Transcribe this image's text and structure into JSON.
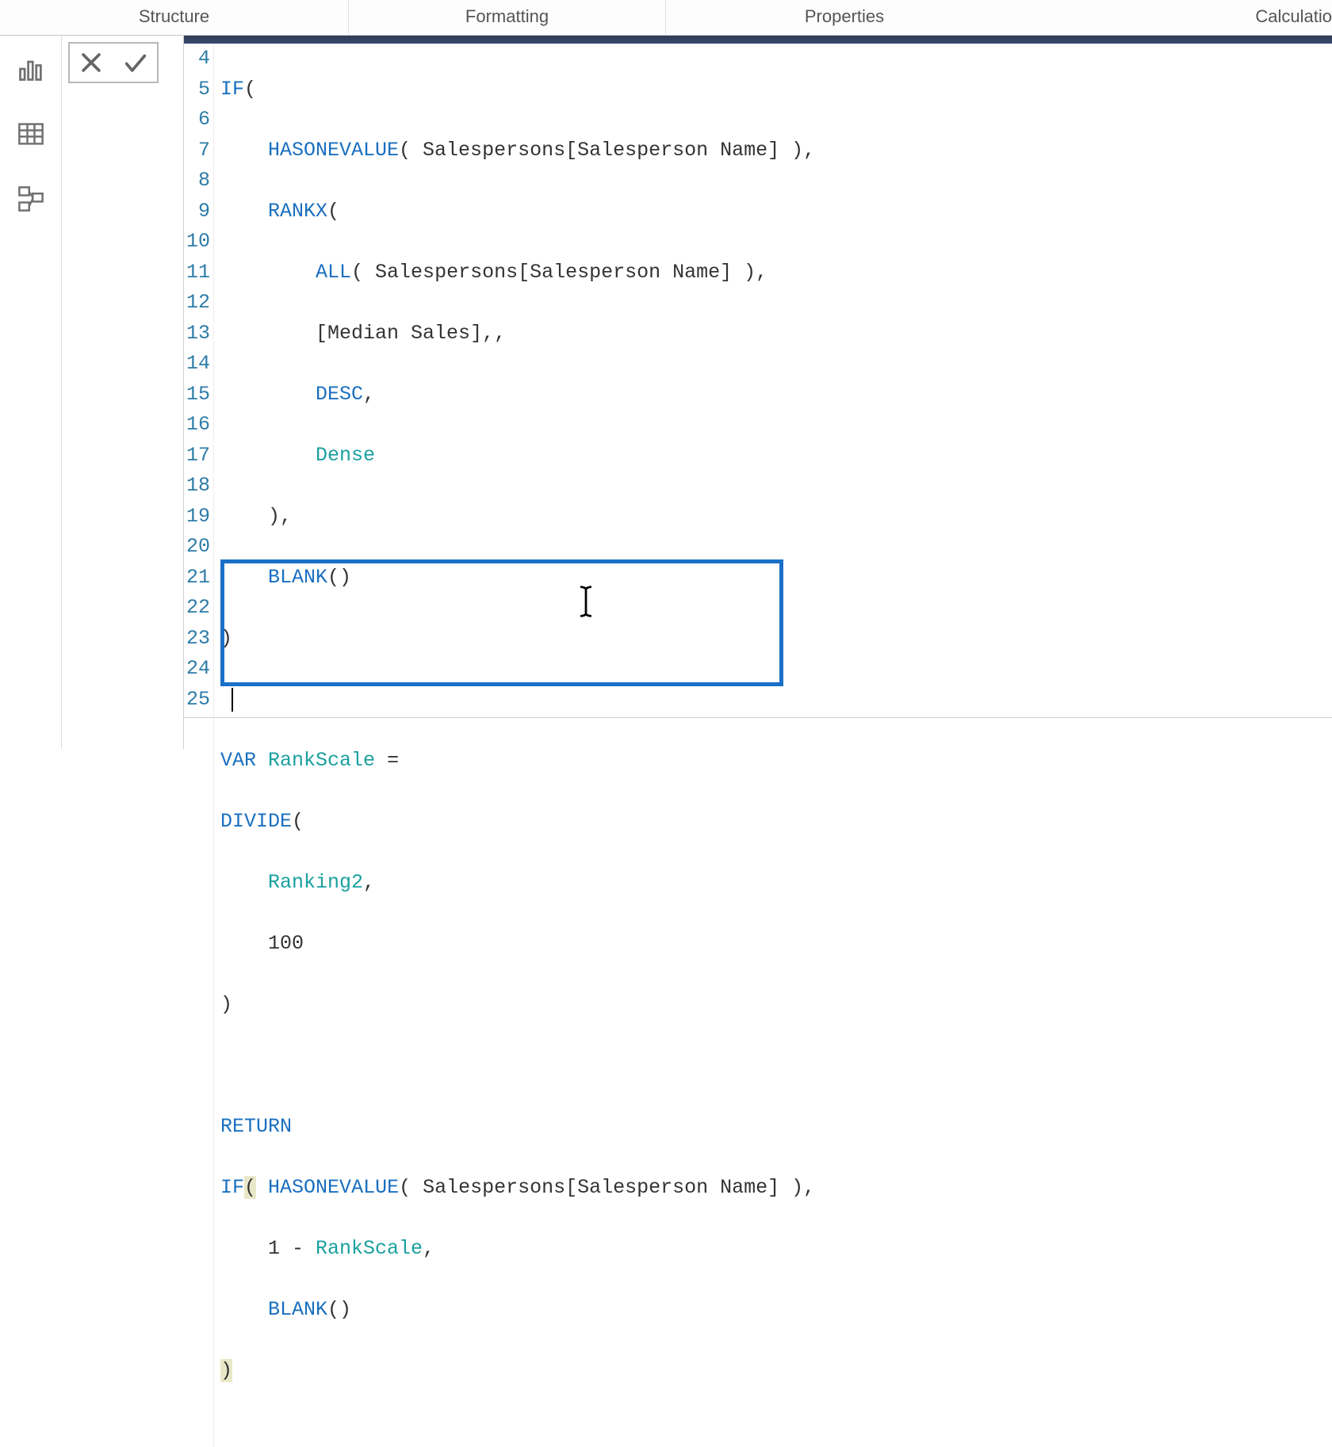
{
  "ribbon": {
    "tabs": {
      "structure": "Structure",
      "formatting": "Formatting",
      "properties": "Properties",
      "calculations": "Calculatio"
    }
  },
  "gutter": {
    "start": 4,
    "end": 25
  },
  "code": {
    "l4": {
      "fn": "IF",
      "rest": "("
    },
    "l5": {
      "fn": "HASONEVALUE",
      "rest1": "( Salespersons[Salesperson Name] ),"
    },
    "l6": {
      "fn": "RANKX",
      "rest": "("
    },
    "l7": {
      "fn": "ALL",
      "rest": "( Salespersons[Salesperson Name] ),"
    },
    "l8": {
      "rest": "[Median Sales],,"
    },
    "l9": {
      "fn": "DESC",
      "rest": ","
    },
    "l10": {
      "ident": "Dense"
    },
    "l11": {
      "rest": "),"
    },
    "l12": {
      "fn": "BLANK",
      "rest": "()"
    },
    "l13": {
      "rest": ")"
    },
    "l14": {
      "rest": ""
    },
    "l15": {
      "kw": "VAR",
      "ident": "RankScale",
      "rest": " ="
    },
    "l16": {
      "fn": "DIVIDE",
      "rest": "("
    },
    "l17": {
      "ident": "Ranking2",
      "rest": ","
    },
    "l18": {
      "num": "100"
    },
    "l19": {
      "rest": ")"
    },
    "l20": {
      "rest": ""
    },
    "l21": {
      "kw": "RETURN"
    },
    "l22": {
      "fn1": "IF",
      "paren": "(",
      "sp": " ",
      "fn2": "HASONEVALUE",
      "rest": "( Salespersons[Salesperson Name] ),"
    },
    "l23": {
      "pre": "1 - ",
      "ident": "RankScale",
      "rest": ","
    },
    "l24": {
      "fn": "BLANK",
      "rest": "()"
    },
    "l25": {
      "paren": ")"
    }
  }
}
